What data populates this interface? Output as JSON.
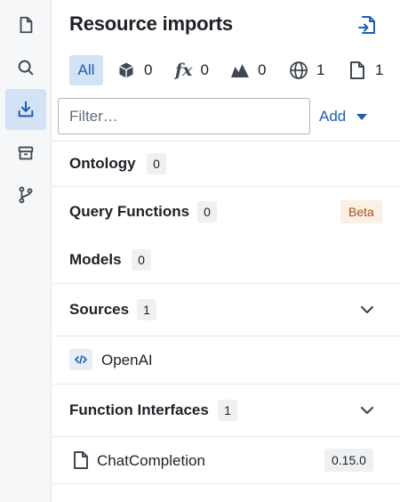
{
  "rail": {
    "items": [
      {
        "icon": "document-icon",
        "active": false
      },
      {
        "icon": "search-icon",
        "active": false
      },
      {
        "icon": "import-icon",
        "active": true
      },
      {
        "icon": "package-icon",
        "active": false
      },
      {
        "icon": "branch-icon",
        "active": false
      }
    ]
  },
  "header": {
    "title": "Resource imports",
    "action_icon": "import-file-icon"
  },
  "filters": {
    "all_label": "All",
    "ontology_count": "0",
    "functions_count": "0",
    "models_count": "0",
    "sources_count": "1",
    "interfaces_count": "1"
  },
  "search": {
    "placeholder": "Filter…",
    "value": ""
  },
  "add_button": {
    "label": "Add"
  },
  "sections": {
    "ontology": {
      "title": "Ontology",
      "count": "0"
    },
    "query_functions": {
      "title": "Query Functions",
      "count": "0",
      "badge": "Beta"
    },
    "models": {
      "title": "Models",
      "count": "0"
    },
    "sources": {
      "title": "Sources",
      "count": "1",
      "items": [
        {
          "label": "OpenAI",
          "icon": "code-icon"
        }
      ]
    },
    "function_interfaces": {
      "title": "Function Interfaces",
      "count": "1",
      "items": [
        {
          "label": "ChatCompletion",
          "icon": "document-icon",
          "version": "0.15.0"
        }
      ]
    }
  },
  "colors": {
    "accent": "#215db0",
    "active_bg": "#d3e2f5",
    "beta_bg": "#fcefe3",
    "beta_text": "#a5531b"
  }
}
